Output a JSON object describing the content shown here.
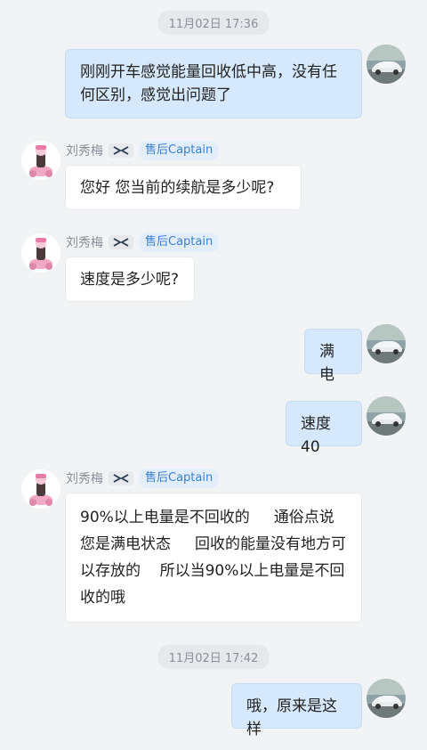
{
  "timestamps": [
    "11月02日 17:36",
    "11月02日 17:42"
  ],
  "agent": {
    "name": "刘秀梅",
    "role": "售后Captain",
    "brand_icon": "x-brand-icon"
  },
  "messages": [
    {
      "from": "me",
      "text": "刚刚开车感觉能量回收低中高，没有任何区别，感觉出问题了"
    },
    {
      "from": "agent",
      "text": "您好   您当前的续航是多少呢?"
    },
    {
      "from": "agent",
      "text": "速度是多少呢?"
    },
    {
      "from": "me",
      "text": "满电"
    },
    {
      "from": "me",
      "text": "速度40"
    },
    {
      "from": "agent",
      "text": "90%以上电量是不回收的     通俗点说您是满电状态     回收的能量没有地方可以存放的    所以当90%以上电量是不回收的哦"
    },
    {
      "from": "me",
      "text": "哦，原来是这样"
    }
  ],
  "colors": {
    "background": "#f2f3f5",
    "my_bubble": "#d6e8fb",
    "agent_bubble": "#ffffff",
    "role_badge_text": "#3b7fd0"
  }
}
